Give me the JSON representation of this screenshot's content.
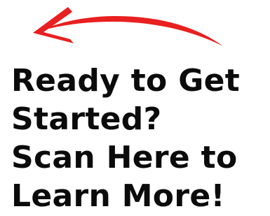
{
  "arrow": {
    "icon": "curved-arrow-left-icon",
    "color": "#e8201f"
  },
  "headline": {
    "lines": [
      "Ready to Get",
      "Started?",
      "Scan Here to",
      "Learn More!"
    ]
  }
}
